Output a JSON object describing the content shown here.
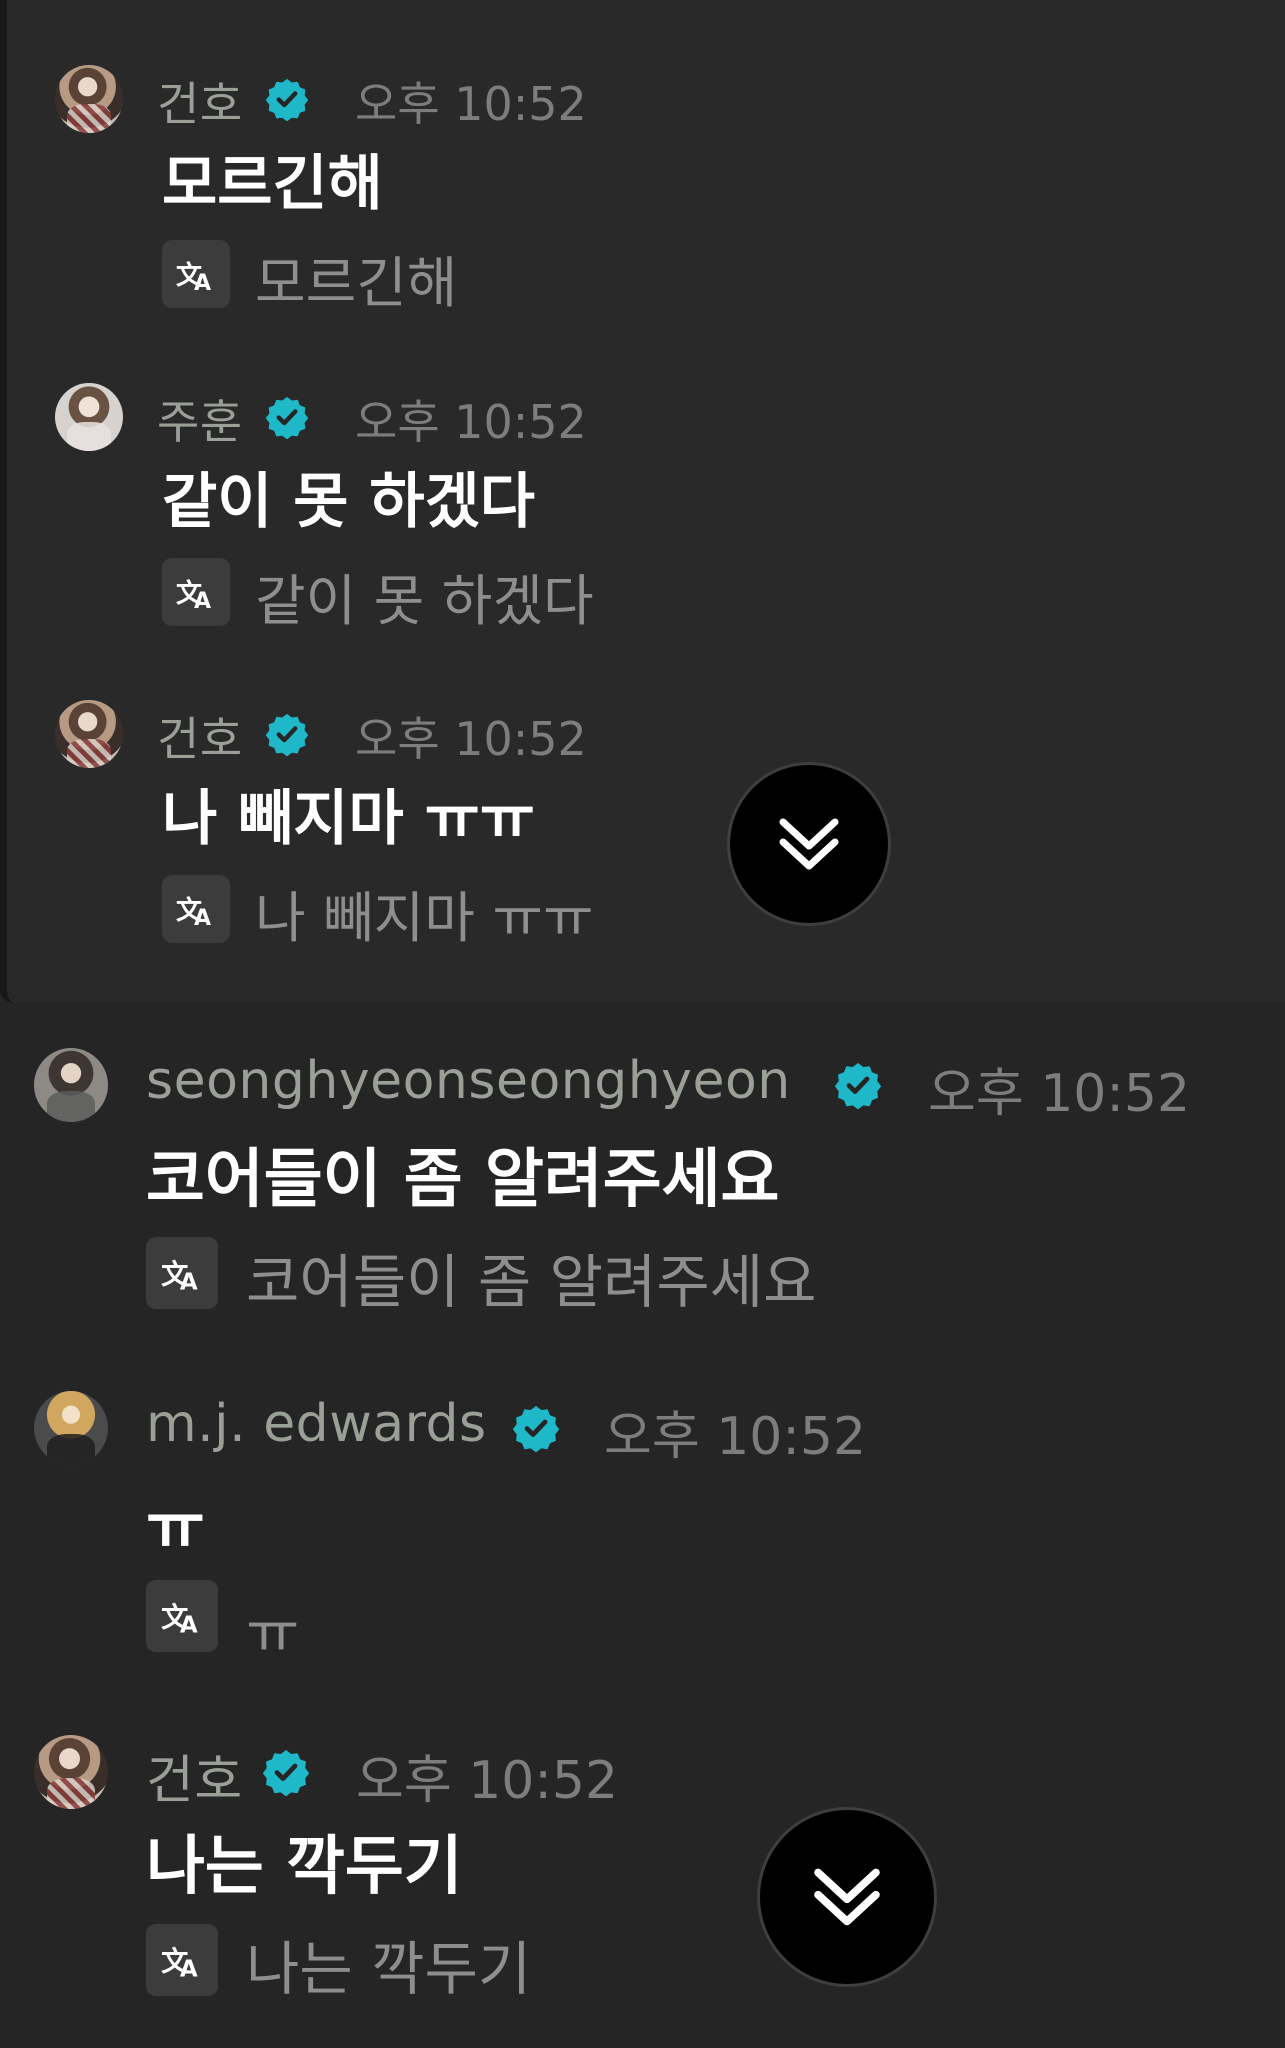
{
  "colors": {
    "verified": "#1fb8c8",
    "background": "#252526",
    "name": "#9a9f98",
    "timestamp": "#7d7d7d"
  },
  "icons": {
    "verified": "verified-badge-icon",
    "translate": "translate-icon",
    "scroll": "double-chevron-down-icon"
  },
  "messages": [
    {
      "author": "건호",
      "time": "오후 10:52",
      "text": "모르긴해",
      "translation": "모르긴해"
    },
    {
      "author": "주훈",
      "time": "오후 10:52",
      "text": "같이 못 하겠다",
      "translation": "같이 못 하겠다"
    },
    {
      "author": "건호",
      "time": "오후 10:52",
      "text": "나 빼지마 ㅠㅠ",
      "translation": "나 빼지마 ㅠㅠ"
    },
    {
      "author": "seonghyeonseonghyeon",
      "time": "오후 10:52",
      "text": "코어들이 좀 알려주세요",
      "translation": "코어들이 좀 알려주세요"
    },
    {
      "author": "m.j. edwards",
      "time": "오후 10:52",
      "text": "ㅠ",
      "translation": "ㅠ"
    },
    {
      "author": "건호",
      "time": "오후 10:52",
      "text": "나는 깍두기",
      "translation": "나는 깍두기"
    }
  ]
}
